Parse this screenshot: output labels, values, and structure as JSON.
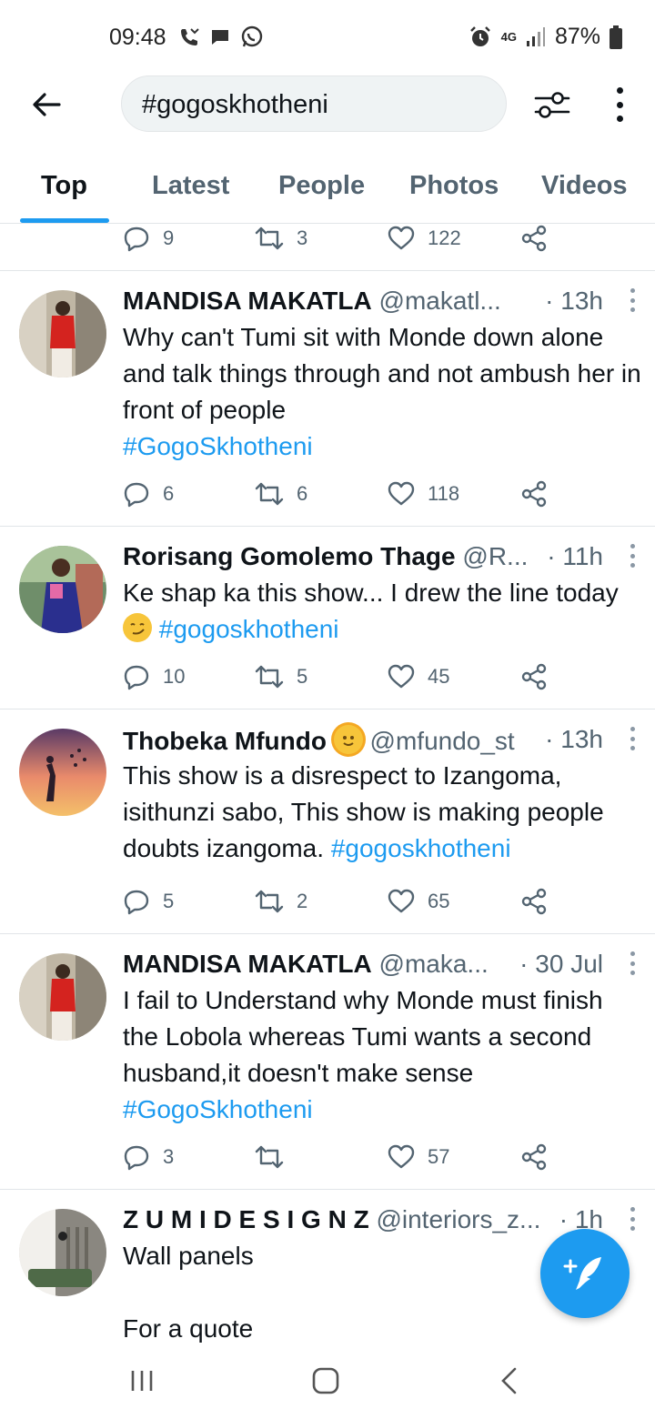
{
  "status_bar": {
    "time": "09:48",
    "battery": "87%",
    "network": "4G",
    "icons": [
      "missed-call-icon",
      "message-icon",
      "whatsapp-icon",
      "alarm-icon",
      "signal-icon",
      "battery-icon"
    ]
  },
  "search": {
    "query": "#gogoskhotheni"
  },
  "tabs": [
    {
      "label": "Top",
      "active": true
    },
    {
      "label": "Latest",
      "active": false
    },
    {
      "label": "People",
      "active": false
    },
    {
      "label": "Photos",
      "active": false
    },
    {
      "label": "Videos",
      "active": false
    }
  ],
  "accent_color": "#1d9bf0",
  "partial_tweet": {
    "replies": "9",
    "retweets": "3",
    "likes": "122"
  },
  "tweets": [
    {
      "name": "MANDISA MAKATLA",
      "handle": "@makatl...",
      "time": "· 13h",
      "text": "Why can't Tumi sit with Monde down alone and talk things through and not ambush her in front of people",
      "hashtag": "#GogoSkhotheni",
      "replies": "6",
      "retweets": "6",
      "likes": "118"
    },
    {
      "name": "Rorisang Gomolemo Thage",
      "handle": "@R...",
      "time": "· 11h",
      "text": "Ke shap ka this show... I drew the line today",
      "hashtag": "#gogoskhotheni",
      "replies": "10",
      "retweets": "5",
      "likes": "45"
    },
    {
      "name": "Thobeka Mfundo",
      "handle": "@mfundo_st",
      "time": "· 13h",
      "text": "This show is a disrespect to Izangoma, isithunzi sabo, This show is making people doubts izangoma.",
      "hashtag": "#gogoskhotheni",
      "replies": "5",
      "retweets": "2",
      "likes": "65"
    },
    {
      "name": "MANDISA MAKATLA",
      "handle": "@maka...",
      "time": "· 30 Jul",
      "text": "I fail to Understand why Monde must finish the Lobola whereas Tumi wants a second husband,it doesn't make sense",
      "hashtag": "#GogoSkhotheni",
      "replies": "3",
      "retweets": "",
      "likes": "57"
    },
    {
      "name": "Z U M I D E S I G N Z",
      "handle": "@interiors_z...",
      "time": "· 1h",
      "text_line1": "Wall panels",
      "text_line2": "For a quote"
    }
  ]
}
